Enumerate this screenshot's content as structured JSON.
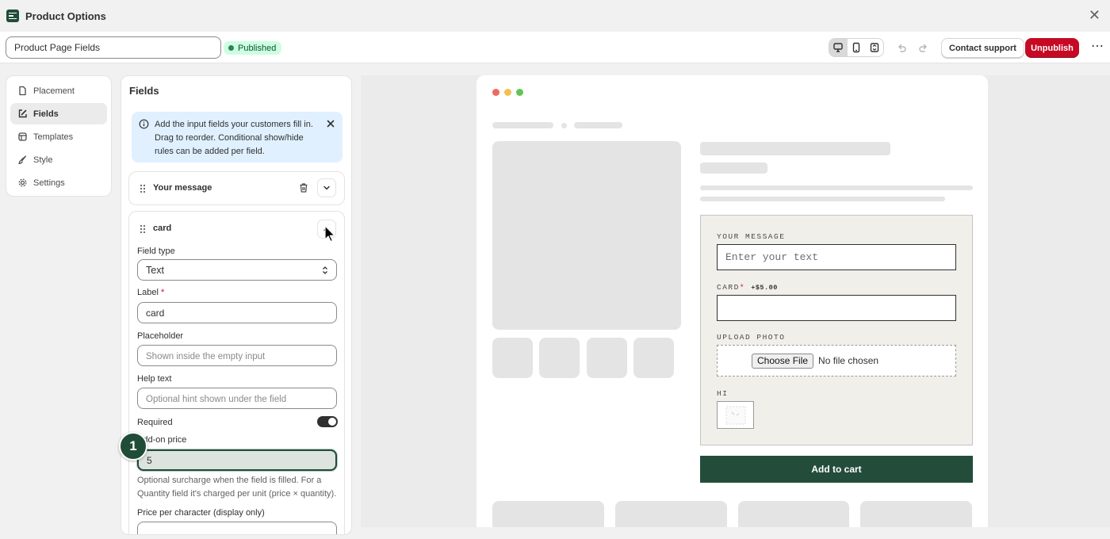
{
  "window": {
    "title": "Product Options"
  },
  "toolbar": {
    "name_value": "Product Page Fields",
    "status": "Published",
    "contact_label": "Contact support",
    "unpublish_label": "Unpublish",
    "more": "⋯"
  },
  "nav": {
    "items": [
      {
        "label": "Placement",
        "icon": "file-icon"
      },
      {
        "label": "Fields",
        "icon": "edit-icon",
        "active": true
      },
      {
        "label": "Templates",
        "icon": "templates-icon"
      },
      {
        "label": "Style",
        "icon": "brush-icon"
      },
      {
        "label": "Settings",
        "icon": "gear-icon"
      }
    ]
  },
  "panel": {
    "title": "Fields",
    "info": "Add the input fields your customers fill in. Drag to reorder. Conditional show/hide rules can be added per field.",
    "fields": [
      {
        "title": "Your message",
        "collapsed": true
      },
      {
        "title": "card",
        "field_type_label": "Field type",
        "field_type_value": "Text",
        "label_label": "Label",
        "required_mark": "*",
        "label_value": "card",
        "placeholder_label": "Placeholder",
        "placeholder_placeholder": "Shown inside the empty input",
        "help_label": "Help text",
        "help_placeholder": "Optional hint shown under the field",
        "required_label": "Required",
        "required_on": true,
        "addon_label": "Add-on price",
        "addon_value": "5",
        "addon_help": "Optional surcharge when the field is filled. For a Quantity field it's charged per unit (price × quantity).",
        "ppc_label": "Price per character (display only)"
      }
    ]
  },
  "step_badge": "1",
  "preview": {
    "fields": {
      "message_label": "YOUR MESSAGE",
      "message_placeholder": "Enter your text",
      "card_label": "CARD",
      "card_star": "*",
      "card_price": "+$5.00",
      "upload_label": "UPLOAD PHOTO",
      "choose_file": "Choose File",
      "no_file": "No file chosen",
      "hi_label": "HI"
    },
    "add_to_cart": "Add to cart"
  },
  "colors": {
    "brand": "#1f4d38",
    "danger": "#c70a24",
    "success_bg": "#cdfee1",
    "info_bg": "#e0f0ff"
  }
}
